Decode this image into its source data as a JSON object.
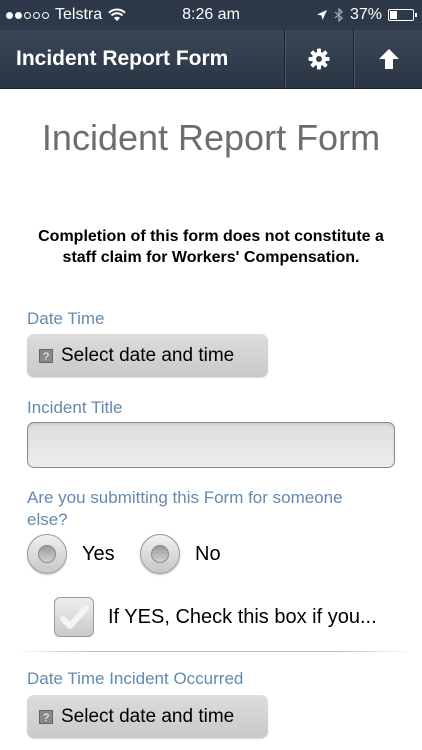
{
  "status_bar": {
    "carrier": "Telstra",
    "time": "8:26 am",
    "battery_percent": "37%",
    "signal_bars_filled": 2,
    "battery_level": 0.37
  },
  "header": {
    "title": "Incident Report Form",
    "settings_icon": "gear-icon",
    "upload_icon": "arrow-up-icon"
  },
  "form": {
    "heading": "Incident Report Form",
    "disclaimer": "Completion of this form does not constitute a staff claim for Workers' Compensation.",
    "date_time": {
      "label": "Date Time",
      "button": "Select date and time"
    },
    "incident_title": {
      "label": "Incident Title",
      "value": ""
    },
    "someone_else": {
      "question": "Are you submitting this Form for someone else?",
      "options": [
        "Yes",
        "No"
      ]
    },
    "checkbox_label": "If YES, Check this box if you...",
    "date_time_occurred": {
      "label": "Date Time Incident Occurred",
      "button": "Select date and time"
    }
  }
}
